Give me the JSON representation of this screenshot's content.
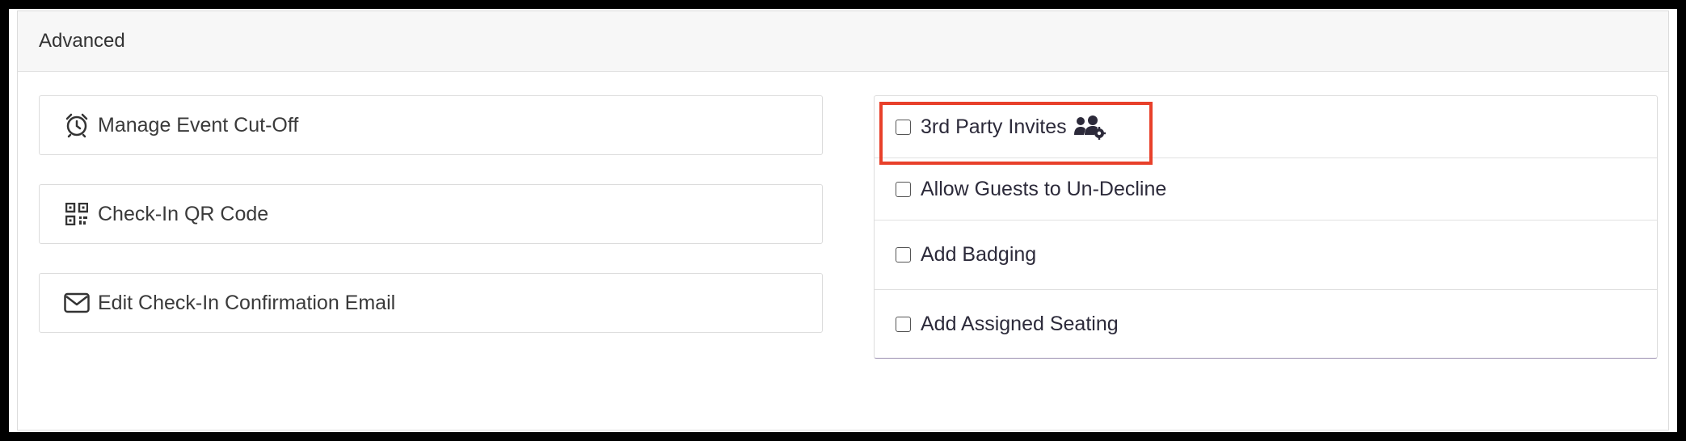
{
  "panel": {
    "title": "Advanced"
  },
  "actions": [
    {
      "label": "Manage Event Cut-Off",
      "icon": "alarm-clock-icon"
    },
    {
      "label": "Check-In QR Code",
      "icon": "qr-code-icon"
    },
    {
      "label": "Edit Check-In Confirmation Email",
      "icon": "envelope-icon"
    }
  ],
  "options": [
    {
      "label": "3rd Party Invites",
      "checked": false,
      "icon": "users-gear-icon"
    },
    {
      "label": "Allow Guests to Un-Decline",
      "checked": false
    },
    {
      "label": "Add Badging",
      "checked": false
    },
    {
      "label": "Add Assigned Seating",
      "checked": false
    }
  ],
  "colors": {
    "highlight": "#e8402a",
    "text": "#3a3a3a",
    "header_bg": "#f7f7f7"
  }
}
